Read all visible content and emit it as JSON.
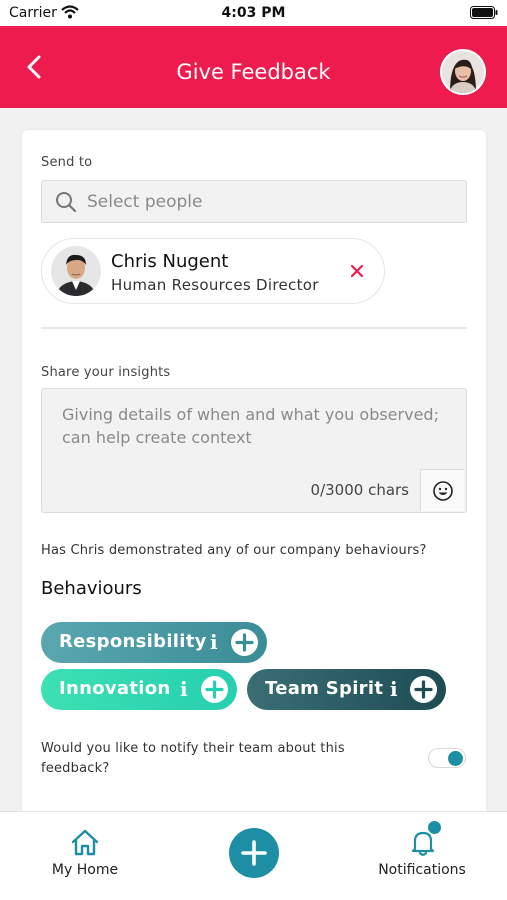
{
  "status_bar": {
    "carrier": "Carrier",
    "time": "4:03 PM"
  },
  "header": {
    "title": "Give Feedback"
  },
  "send_to": {
    "label": "Send to",
    "search_placeholder": "Select people",
    "selected": {
      "name": "Chris Nugent",
      "role": "Human Resources Director"
    }
  },
  "insights": {
    "label": "Share your insights",
    "placeholder": "Giving details of when and what you observed; can help create context",
    "char_count": "0/3000 chars"
  },
  "behaviours": {
    "question": "Has Chris demonstrated any of our company behaviours?",
    "heading": "Behaviours",
    "chips": [
      {
        "label": "Responsibility",
        "info": "i"
      },
      {
        "label": "Innovation",
        "info": "i"
      },
      {
        "label": "Team Spirit",
        "info": "i"
      }
    ]
  },
  "notify": {
    "text": "Would you like to notify their team about this feedback?",
    "enabled": true
  },
  "bottom_nav": {
    "home_label": "My Home",
    "notifications_label": "Notifications"
  },
  "colors": {
    "header": "#ee1b4f",
    "accent": "#1e8ea4"
  }
}
